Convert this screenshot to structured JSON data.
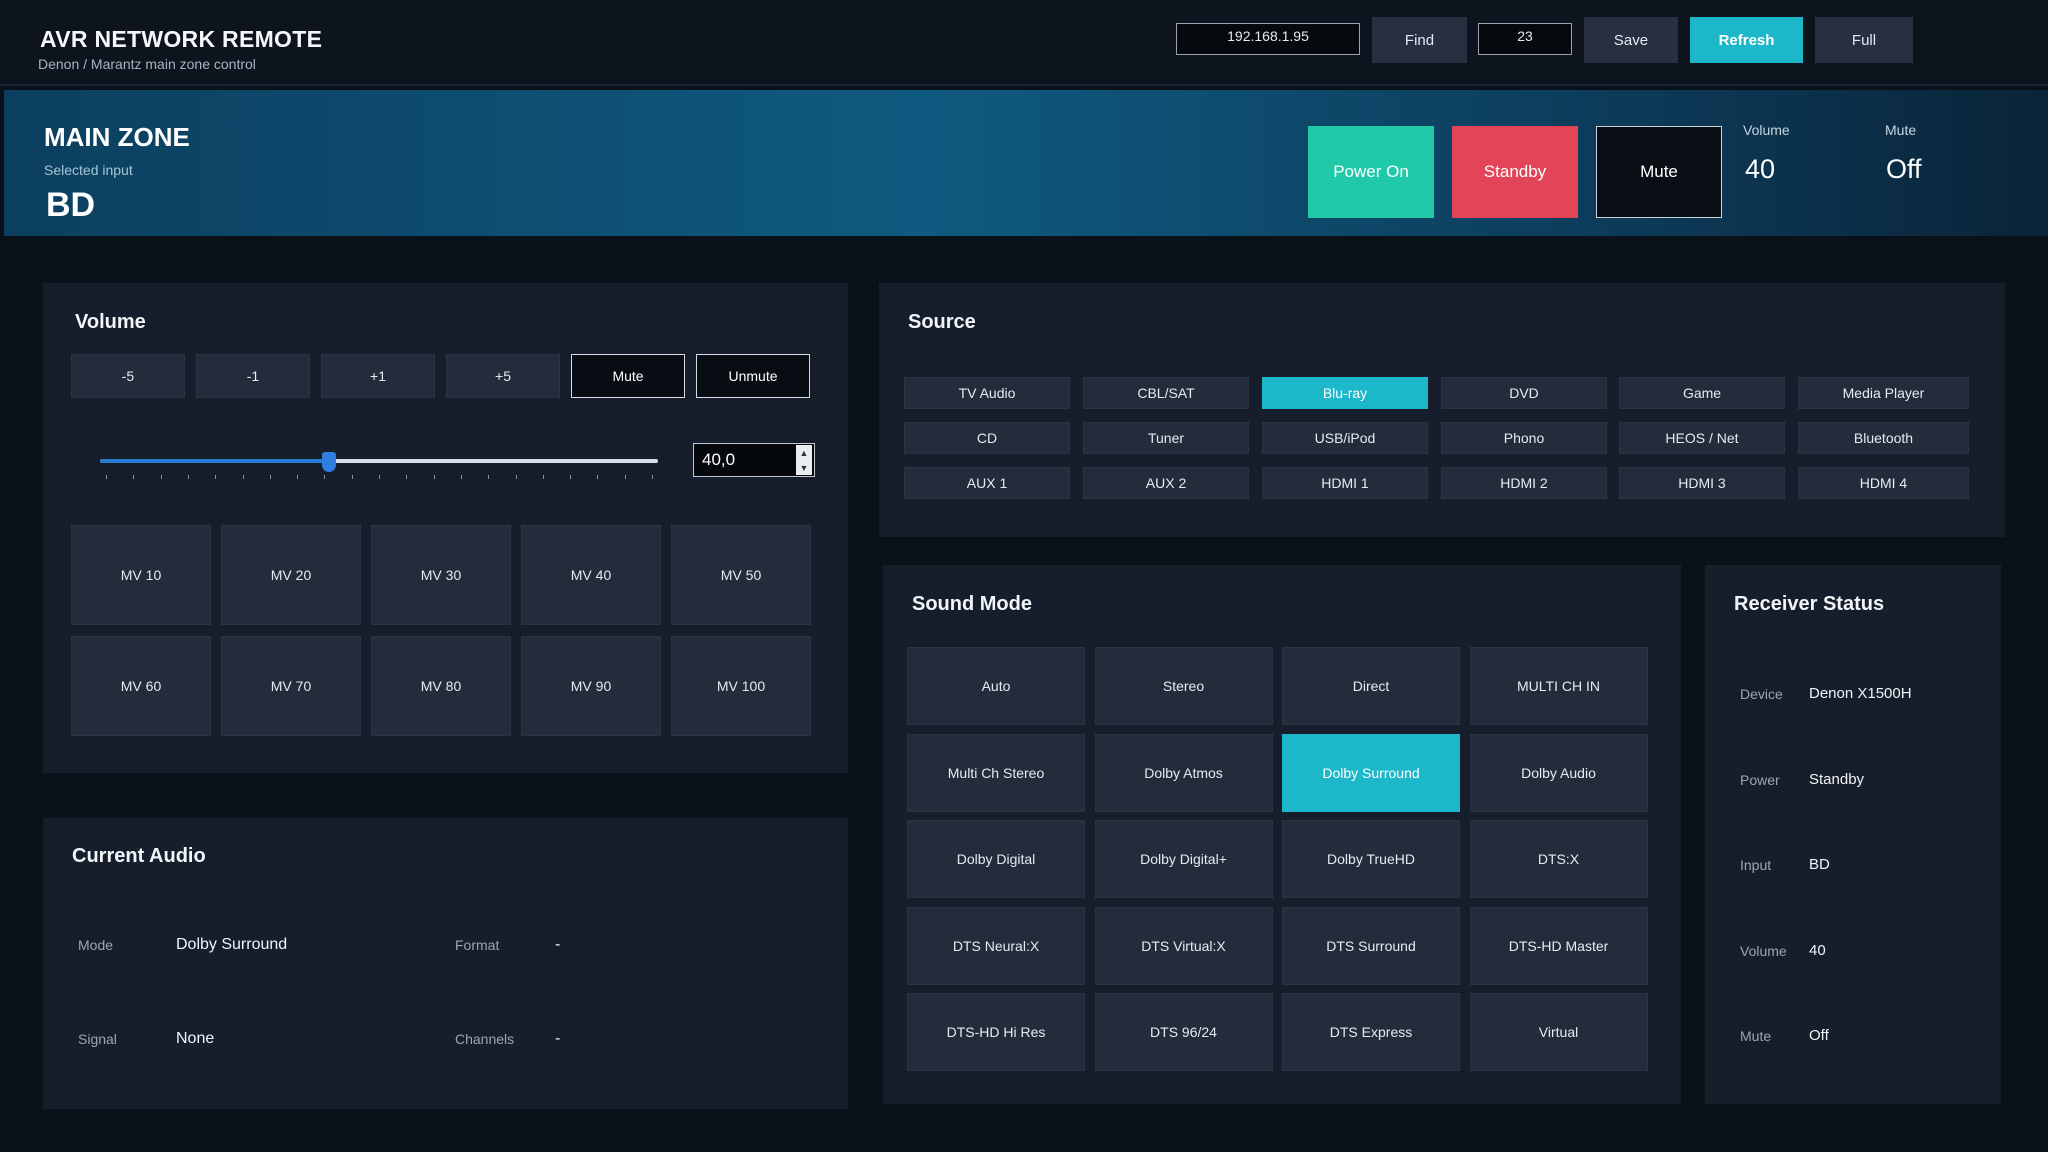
{
  "app": {
    "title": "AVR NETWORK REMOTE",
    "subtitle": "Denon / Marantz main zone control"
  },
  "header": {
    "ip_value": "192.168.1.95",
    "find_label": "Find",
    "port_value": "23",
    "save_label": "Save",
    "refresh_label": "Refresh",
    "full_label": "Full"
  },
  "zone": {
    "title": "MAIN ZONE",
    "selected_label": "Selected input",
    "selected_input": "BD",
    "power_on_label": "Power On",
    "standby_label": "Standby",
    "mute_label": "Mute",
    "volume_label": "Volume",
    "volume_value": "40",
    "mute_status_label": "Mute",
    "mute_status_value": "Off"
  },
  "volume_panel": {
    "title": "Volume",
    "step_buttons": [
      "-5",
      "-1",
      "+1",
      "+5",
      "Mute",
      "Unmute"
    ],
    "slider_fraction": 0.41,
    "spin_value": "40,0",
    "presets": [
      "MV 10",
      "MV 20",
      "MV 30",
      "MV 40",
      "MV 50",
      "MV 60",
      "MV 70",
      "MV 80",
      "MV 90",
      "MV 100"
    ]
  },
  "source_panel": {
    "title": "Source",
    "sources": [
      "TV Audio",
      "CBL/SAT",
      "Blu-ray",
      "DVD",
      "Game",
      "Media Player",
      "CD",
      "Tuner",
      "USB/iPod",
      "Phono",
      "HEOS / Net",
      "Bluetooth",
      "AUX 1",
      "AUX 2",
      "HDMI 1",
      "HDMI 2",
      "HDMI 3",
      "HDMI 4"
    ],
    "active": "Blu-ray"
  },
  "current_audio": {
    "title": "Current Audio",
    "mode_label": "Mode",
    "mode_value": "Dolby Surround",
    "format_label": "Format",
    "format_value": "-",
    "signal_label": "Signal",
    "signal_value": "None",
    "channels_label": "Channels",
    "channels_value": "-"
  },
  "sound_mode": {
    "title": "Sound Mode",
    "modes": [
      "Auto",
      "Stereo",
      "Direct",
      "MULTI CH IN",
      "Multi Ch Stereo",
      "Dolby Atmos",
      "Dolby Surround",
      "Dolby Audio",
      "Dolby Digital",
      "Dolby Digital+",
      "Dolby TrueHD",
      "DTS:X",
      "DTS Neural:X",
      "DTS Virtual:X",
      "DTS Surround",
      "DTS-HD Master",
      "DTS-HD Hi Res",
      "DTS 96/24",
      "DTS Express",
      "Virtual"
    ],
    "active": "Dolby Surround"
  },
  "receiver_status": {
    "title": "Receiver Status",
    "rows": [
      {
        "label": "Device",
        "value": "Denon X1500H"
      },
      {
        "label": "Power",
        "value": "Standby"
      },
      {
        "label": "Input",
        "value": "BD"
      },
      {
        "label": "Volume",
        "value": "40"
      },
      {
        "label": "Mute",
        "value": "Off"
      }
    ]
  },
  "colors": {
    "accent": "#1cb7c8",
    "power_on": "#20c9a8",
    "standby": "#e34558",
    "slider": "#2a7bd6"
  }
}
